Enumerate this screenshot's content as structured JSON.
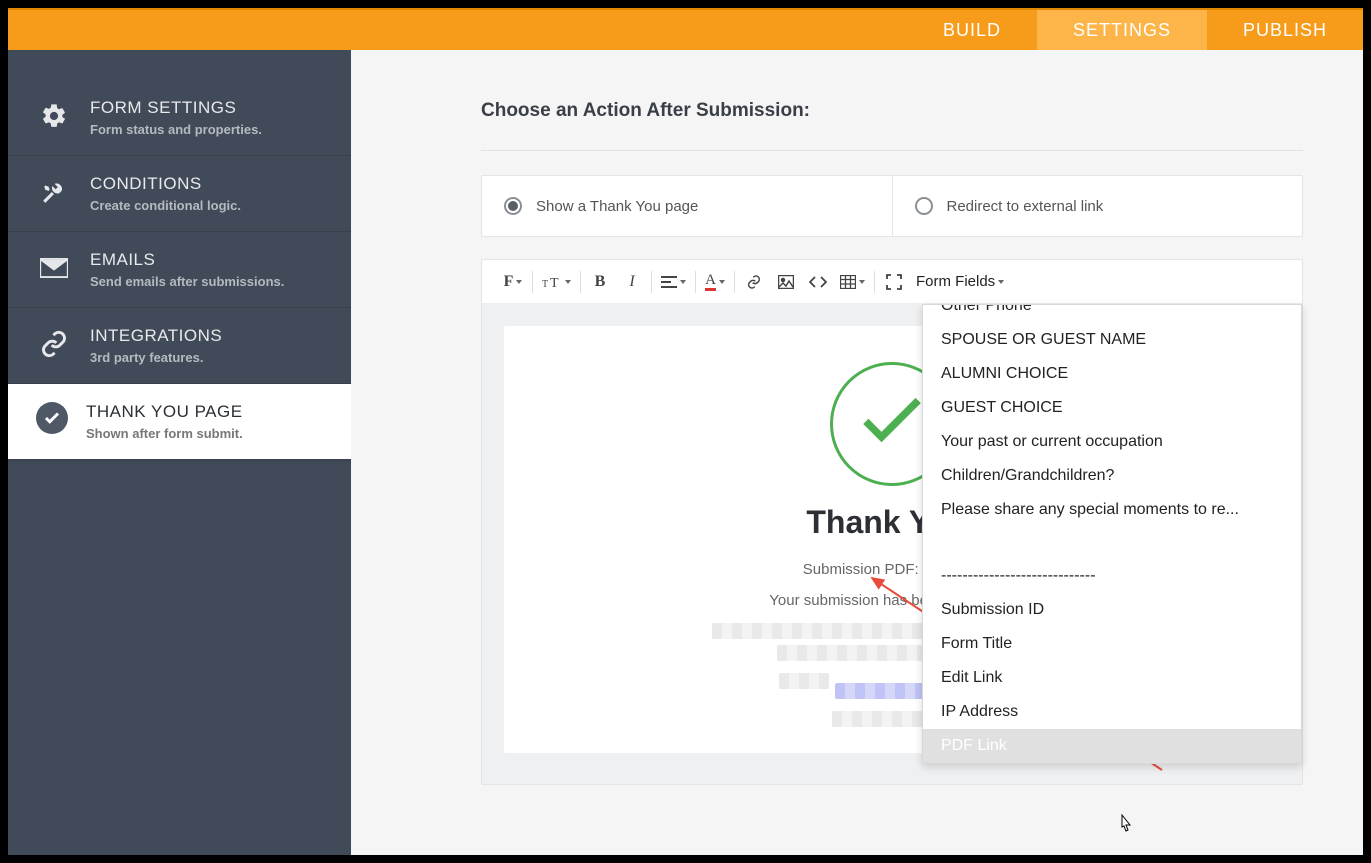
{
  "nav": {
    "build": "BUILD",
    "settings": "SETTINGS",
    "publish": "PUBLISH"
  },
  "sidebar": {
    "items": [
      {
        "title": "FORM SETTINGS",
        "sub": "Form status and properties."
      },
      {
        "title": "CONDITIONS",
        "sub": "Create conditional logic."
      },
      {
        "title": "EMAILS",
        "sub": "Send emails after submissions."
      },
      {
        "title": "INTEGRATIONS",
        "sub": "3rd party features."
      },
      {
        "title": "THANK YOU PAGE",
        "sub": "Shown after form submit."
      }
    ]
  },
  "content": {
    "heading": "Choose an Action After Submission:",
    "option_thankyou": "Show a Thank You page",
    "option_redirect": "Redirect to external link"
  },
  "toolbar": {
    "font": "F",
    "formfields_label": "Form Fields"
  },
  "thank": {
    "title": "Thank You!",
    "pdf_line": "Submission PDF: {pdf-link}",
    "received_line": "Your submission has been received -"
  },
  "dropdown": {
    "items": [
      "Other Phone",
      "SPOUSE OR GUEST NAME",
      "ALUMNI CHOICE",
      "GUEST CHOICE",
      "Your past or current occupation",
      "Children/Grandchildren?",
      "Please share any special moments to re..."
    ],
    "divider": "-----------------------------",
    "meta": [
      "Submission ID",
      "Form Title",
      "Edit Link",
      "IP Address",
      "PDF Link"
    ]
  }
}
